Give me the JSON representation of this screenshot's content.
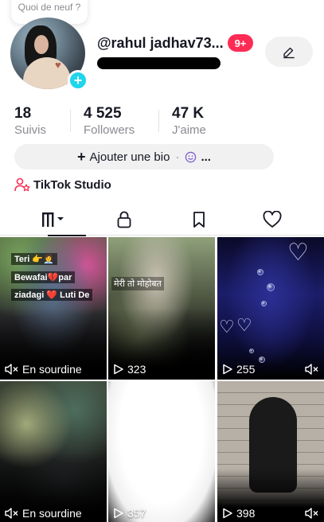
{
  "header": {
    "note": "Quoi de neuf ?",
    "username": "@rahul jadhav73...",
    "notification_badge": "9+"
  },
  "stats": [
    {
      "value": "18",
      "label": "Suivis"
    },
    {
      "value": "4 525",
      "label": "Followers"
    },
    {
      "value": "47 K",
      "label": "J'aime"
    }
  ],
  "bio_button": {
    "label": "Ajouter une bio",
    "extra": "..."
  },
  "studio": {
    "label": "TikTok Studio"
  },
  "tabs": [
    {
      "icon": "videos-grid-icon",
      "active": true
    },
    {
      "icon": "lock-icon",
      "active": false
    },
    {
      "icon": "bookmark-icon",
      "active": false
    },
    {
      "icon": "heart-icon",
      "active": false
    }
  ],
  "videos": [
    {
      "overlay_lines": [
        "Teri 👉🧑‍💼",
        "Bewafai💔par",
        "ziadagi ❤️ Luti De"
      ],
      "footer_icon": "muted-speaker-icon",
      "footer_text": "En sourdine"
    },
    {
      "overlay_text": "मेरी तो मोहोबत",
      "footer_icon": "play-icon",
      "footer_text": "323"
    },
    {
      "footer_icon": "play-icon",
      "footer_text": "255",
      "right_icon": "muted-speaker-icon"
    },
    {
      "footer_icon": "muted-speaker-icon",
      "footer_text": "En sourdine"
    },
    {
      "footer_icon": "play-icon",
      "footer_text": "357"
    },
    {
      "footer_icon": "play-icon",
      "footer_text": "398",
      "right_icon": "muted-speaker-icon"
    }
  ],
  "colors": {
    "accent_red": "#fe2c55",
    "add_badge": "#20d5ec",
    "text_primary": "#161823",
    "text_secondary": "#8a8b91",
    "button_bg": "#f1f1f2"
  }
}
